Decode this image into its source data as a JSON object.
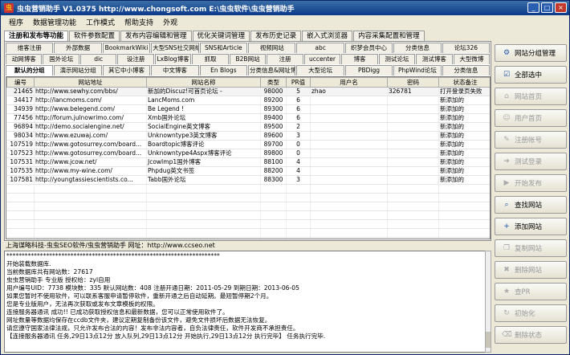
{
  "window": {
    "title": "虫虫营销助手 V1.0375 http://www.chongsoft.com E:\\虫虫软件\\虫虫营销助手"
  },
  "menu": [
    "程序",
    "数据管理功能",
    "工作模式",
    "帮助支持",
    "外观"
  ],
  "main_tabs": [
    "注册和发布等功能",
    "软件参数配置",
    "发布内容编辑和管理",
    "优化关键词管理",
    "发布历史记录",
    "嵌入式浏览器",
    "内容采集配置和管理"
  ],
  "site_tabs": {
    "row1": [
      "维客注册",
      "外部数据",
      "BookmarkWiki",
      "大型SNS社交网络",
      "SNS和Article",
      "视频网站",
      "abc",
      "织梦会员中心",
      "分类信息",
      "论坛326"
    ],
    "row2": [
      "动网博客",
      "国外论坛",
      "dic",
      "设注册",
      "LxBlog博客",
      "抓取",
      "B2B网站",
      "注册",
      "uccenter",
      "博客",
      "测试论坛",
      "测试博客",
      "大型微博"
    ],
    "row3": [
      "默认的分组",
      "演示网站分组",
      "其它中小博客",
      "中文博客",
      "En Blogs",
      "分类信息&网址博客",
      "大型论坛",
      "PBDigg",
      "PhpWind论坛",
      "分类信息"
    ]
  },
  "grid": {
    "columns": [
      "编号",
      "网站地址",
      "网站名称",
      "类型",
      "PR值",
      "用户名",
      "密码",
      "状态备注"
    ],
    "rows": [
      [
        "21465",
        "http://www.sewhy.com/bbs/",
        "新加的Discuz!可首页论坛 -",
        "98000",
        "5",
        "zhao",
        "326781",
        "打开登录页失败"
      ],
      [
        "34417",
        "http://lancmoms.com/",
        "LancMoms.com",
        "89200",
        "6",
        "",
        "",
        "新添加的"
      ],
      [
        "34939",
        "http://www.belegend.com/",
        "Be Legend !",
        "89300",
        "6",
        "",
        "",
        "新添加的"
      ],
      [
        "77456",
        "http://forum.julnowrimo.com/",
        "Xmb国外论坛",
        "89400",
        "6",
        "",
        "",
        "新添加的"
      ],
      [
        "96894",
        "http://demo.socialengine.net/",
        "SocialEngine英文博客",
        "89500",
        "2",
        "",
        "",
        "新添加的"
      ],
      [
        "98034",
        "http://www.ezuwaj.com/",
        "Unknowntype3英文博客",
        "89600",
        "3",
        "",
        "",
        "新添加的"
      ],
      [
        "107519",
        "http://www.gotosurrey.com/board...",
        "Boardtopic博客评论",
        "89700",
        "0",
        "",
        "",
        "新添加的"
      ],
      [
        "107523",
        "http://www.gotosurrey.com/board...",
        "Unknowntype4Aspx博客评论",
        "89800",
        "0",
        "",
        "",
        "新添加的"
      ],
      [
        "107531",
        "http://www.jcow.net/",
        "JcowImp1国外博客",
        "88100",
        "4",
        "",
        "",
        "新添加的"
      ],
      [
        "107535",
        "http://www.my-wine.com/",
        "Phpdug英文书签",
        "88200",
        "4",
        "",
        "",
        "新添加的"
      ],
      [
        "107581",
        "http://youngtassiescientists.co...",
        "Tabb国外论坛",
        "88300",
        "3",
        "",
        "",
        "新添加的"
      ]
    ]
  },
  "sidebar": {
    "buttons": [
      {
        "label": "网站分组管理",
        "icon": "group-icon",
        "enabled": true
      },
      {
        "label": "全部选中",
        "icon": "select-all-icon",
        "enabled": true
      },
      {
        "label": "网站首页",
        "icon": "home-icon",
        "enabled": false
      },
      {
        "label": "用户首页",
        "icon": "user-icon",
        "enabled": false
      },
      {
        "label": "注册帐号",
        "icon": "register-icon",
        "enabled": false
      },
      {
        "label": "测试登录",
        "icon": "login-icon",
        "enabled": false
      },
      {
        "label": "开始发布",
        "icon": "publish-icon",
        "enabled": false
      },
      {
        "label": "查找网站",
        "icon": "search-icon",
        "enabled": true
      },
      {
        "label": "添加网站",
        "icon": "add-icon",
        "enabled": true
      },
      {
        "label": "复制网站",
        "icon": "copy-icon",
        "enabled": false
      },
      {
        "label": "删除网站",
        "icon": "delete-icon",
        "enabled": false
      },
      {
        "label": "查PR",
        "icon": "pagerank-icon",
        "enabled": false
      },
      {
        "label": "初始化",
        "icon": "init-icon",
        "enabled": false
      },
      {
        "label": "删除状态",
        "icon": "clear-status-icon",
        "enabled": false
      }
    ]
  },
  "status_url": "上海谋略科技-虫虫SEO软件/虫虫营销助手 网址：http://www.ccseo.net",
  "log": [
    "**********************************************************************",
    "开始装载数据库.",
    "当前数据库共有网站数：27617",
    "虫虫营销助手 专业版 授权给：zyl自用",
    "用户编号UID：7738 模块数：335 默认网站数：408 注册开通日期：2011-05-29    到期日期：2013-06-05",
    "如果您暂时不使用软件，可以联系客服申请暂停软件，重新开通之后自动延期。最短暂停期2个月。",
    "您是专业版用户，无法再次获取或发布文章模板的权限。",
    "连接服务器通讯 成功!! 已成功获取授权信息和最新数据，您可以正常使用软件了。",
    "网址数量等数据均保存在ccdb文件夹，建议定期复制备份该文件，避免文件损坏后数据无法恢复。",
    "请您遵守国家法律法规，只允许发布合法的内容！发布非法内容者，自负法律责任，软件开发商不承担责任。",
    "【连接服务器通讯 任务,29日13点12分 放入队列,29日13点12分 开始执行,29日13点12分 执行完毕】 任务执行完毕."
  ]
}
